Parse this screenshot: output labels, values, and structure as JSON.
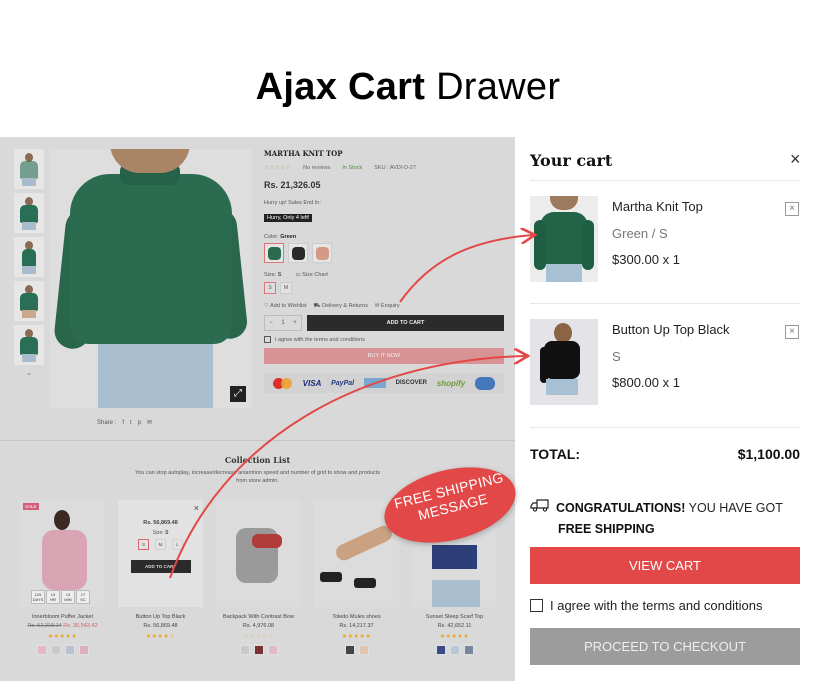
{
  "banner": {
    "title_bold": "Ajax Cart",
    "title_light": "Drawer"
  },
  "store": {
    "product": {
      "title": "MARTHA KNIT TOP",
      "stars": "☆☆☆☆☆",
      "reviews": "No reviews",
      "stock": "In Stock",
      "sku": "SKU : AVDI-D-27",
      "price": "Rs. 21,326.05",
      "hurry_label": "Hurry up! Sales End In:",
      "hurry_badge": "Hurry, Only 4 left!",
      "color_label": "Color:",
      "color_value": "Green",
      "size_label": "Size:",
      "size_value": "S",
      "size_chart": "Size Chart",
      "sizes": [
        "S",
        "M"
      ],
      "wishlist": "Add to Wishlist",
      "delivery": "Delivery & Returns",
      "enquiry": "Enquiry",
      "qty_minus": "−",
      "qty_value": "1",
      "qty_plus": "+",
      "add_to_cart": "ADD TO CART",
      "agree": "I agree with the terms and conditions",
      "buy_now": "BUY IT NOW",
      "payments": {
        "visa": "VISA",
        "paypal": "PayPal",
        "discover": "DISCOVER",
        "shopify": "shopify"
      },
      "share_label": "Share :",
      "share_icons": [
        "f",
        "t",
        "p",
        "✉"
      ],
      "zoom_icon": "⤢"
    },
    "collection": {
      "title": "Collection List",
      "subtitle": "You can stop autoplay, increase/decrease aniamtion speed and number of grid to show and products from store admin.",
      "products": [
        {
          "name": "Innerbloom Puffer Jacket",
          "old_price": "Rs. 52,318.14",
          "price": "Rs. 35,543.42",
          "stars": "★★★★★",
          "sale": "SALE",
          "countdown": [
            {
              "n": "129",
              "u": "DAYS"
            },
            {
              "n": "13",
              "u": "HR"
            },
            {
              "n": "13",
              "u": "MIN"
            },
            {
              "n": "17",
              "u": "SC"
            }
          ]
        },
        {
          "name": "Button Up Top Black",
          "price": "Rs. 56,869.48",
          "stars": "★★★★☆",
          "quick": {
            "price": "Rs. 56,869.48",
            "size_label": "Size:",
            "size_value": "S",
            "sizes": [
              "S",
              "M",
              "L"
            ],
            "add": "ADD TO CART",
            "close": "×"
          }
        },
        {
          "name": "Backpack With Contrast Bow",
          "price": "Rs. 4,976.08",
          "stars": "☆☆☆☆☆"
        },
        {
          "name": "Toledo Mules shoes",
          "price": "Rs. 14,217.37",
          "stars": "★★★★★"
        },
        {
          "name": "Sunset Sleep Scarf Top",
          "price": "Rs. 42,652.11",
          "stars": "★★★★★"
        }
      ]
    }
  },
  "drawer": {
    "title": "Your cart",
    "close_icon": "×",
    "items": [
      {
        "name": "Martha Knit Top",
        "variant": "Green / S",
        "price": "$300.00 x 1",
        "remove": "×"
      },
      {
        "name": "Button Up Top Black",
        "variant": "S",
        "price": "$800.00 x 1",
        "remove": "×"
      }
    ],
    "total_label": "TOTAL:",
    "total_value": "$1,100.00",
    "shipping": {
      "bold1": "CONGRATULATIONS!",
      "rest": " YOU HAVE GOT",
      "bold2": "FREE SHIPPING"
    },
    "view_cart": "VIEW CART",
    "agree": "I agree with the terms and conditions",
    "checkout": "PROCEED TO CHECKOUT"
  },
  "annotation": {
    "bubble_line1": "FREE SHIPPING",
    "bubble_line2": "MESSAGE"
  },
  "colors": {
    "accent": "#e34848",
    "checkout_disabled": "#9c9c9c",
    "dim_overlay": "#d9d9d9"
  }
}
